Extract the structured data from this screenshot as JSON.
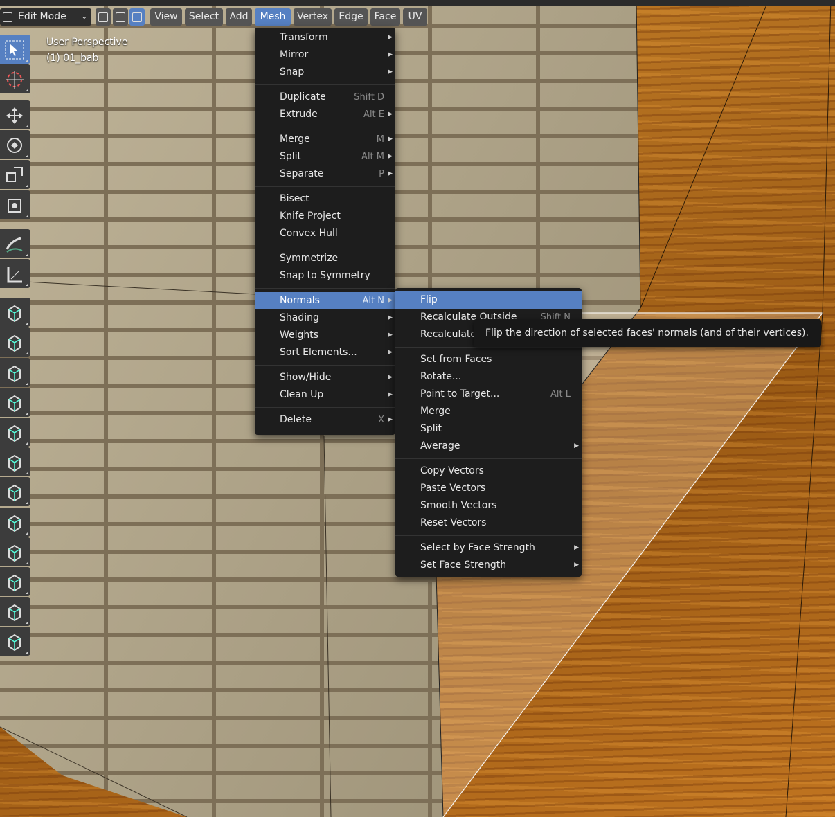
{
  "header": {
    "mode": "Edit Mode",
    "menus": [
      "View",
      "Select",
      "Add",
      "Mesh",
      "Vertex",
      "Edge",
      "Face",
      "UV"
    ],
    "active_menu": "Mesh"
  },
  "viewport": {
    "perspective": "User Perspective",
    "object": "(1) 01_bab"
  },
  "mesh_menu": {
    "items": [
      {
        "label": "Transform",
        "shortcut": "",
        "submenu": true
      },
      {
        "label": "Mirror",
        "shortcut": "",
        "submenu": true
      },
      {
        "label": "Snap",
        "shortcut": "",
        "submenu": true
      },
      {
        "label": "Duplicate",
        "shortcut": "Shift D",
        "submenu": false
      },
      {
        "label": "Extrude",
        "shortcut": "Alt E",
        "submenu": true
      },
      {
        "label": "Merge",
        "shortcut": "M",
        "submenu": true
      },
      {
        "label": "Split",
        "shortcut": "Alt M",
        "submenu": true
      },
      {
        "label": "Separate",
        "shortcut": "P",
        "submenu": true
      },
      {
        "label": "Bisect",
        "shortcut": "",
        "submenu": false
      },
      {
        "label": "Knife Project",
        "shortcut": "",
        "submenu": false
      },
      {
        "label": "Convex Hull",
        "shortcut": "",
        "submenu": false
      },
      {
        "label": "Symmetrize",
        "shortcut": "",
        "submenu": false
      },
      {
        "label": "Snap to Symmetry",
        "shortcut": "",
        "submenu": false
      },
      {
        "label": "Normals",
        "shortcut": "Alt N",
        "submenu": true
      },
      {
        "label": "Shading",
        "shortcut": "",
        "submenu": true
      },
      {
        "label": "Weights",
        "shortcut": "",
        "submenu": true
      },
      {
        "label": "Sort Elements...",
        "shortcut": "",
        "submenu": true
      },
      {
        "label": "Show/Hide",
        "shortcut": "",
        "submenu": true
      },
      {
        "label": "Clean Up",
        "shortcut": "",
        "submenu": true
      },
      {
        "label": "Delete",
        "shortcut": "X",
        "submenu": true
      }
    ]
  },
  "normals_menu": {
    "items": [
      {
        "label": "Flip",
        "shortcut": "",
        "submenu": false
      },
      {
        "label": "Recalculate Outside",
        "shortcut": "Shift N",
        "submenu": false
      },
      {
        "label": "Recalculate",
        "shortcut": "",
        "submenu": false
      },
      {
        "label": "Set from Faces",
        "shortcut": "",
        "submenu": false
      },
      {
        "label": "Rotate...",
        "shortcut": "",
        "submenu": false
      },
      {
        "label": "Point to Target...",
        "shortcut": "Alt L",
        "submenu": false
      },
      {
        "label": "Merge",
        "shortcut": "",
        "submenu": false
      },
      {
        "label": "Split",
        "shortcut": "",
        "submenu": false
      },
      {
        "label": "Average",
        "shortcut": "",
        "submenu": true
      },
      {
        "label": "Copy Vectors",
        "shortcut": "",
        "submenu": false
      },
      {
        "label": "Paste Vectors",
        "shortcut": "",
        "submenu": false
      },
      {
        "label": "Smooth Vectors",
        "shortcut": "",
        "submenu": false
      },
      {
        "label": "Reset Vectors",
        "shortcut": "",
        "submenu": false
      },
      {
        "label": "Select by Face Strength",
        "shortcut": "",
        "submenu": true
      },
      {
        "label": "Set Face Strength",
        "shortcut": "",
        "submenu": true
      }
    ]
  },
  "tooltip": {
    "text": "Flip the direction of selected faces' normals (and of their vertices)."
  },
  "toolbar": {
    "tools": [
      "select-box-icon",
      "cursor-icon",
      "move-icon",
      "rotate-icon",
      "scale-icon",
      "transform-icon",
      "annotate-icon",
      "measure-icon",
      "extrude-region-icon",
      "inset-faces-icon",
      "bevel-icon",
      "loop-cut-icon",
      "knife-icon",
      "poly-build-icon",
      "spin-icon",
      "smooth-icon",
      "edge-slide-icon",
      "shrink-fatten-icon",
      "shear-icon",
      "rip-region-icon"
    ]
  },
  "colors": {
    "accent": "#5680c2",
    "menu_bg": "#1d1d1d",
    "header_btn": "#545454"
  }
}
